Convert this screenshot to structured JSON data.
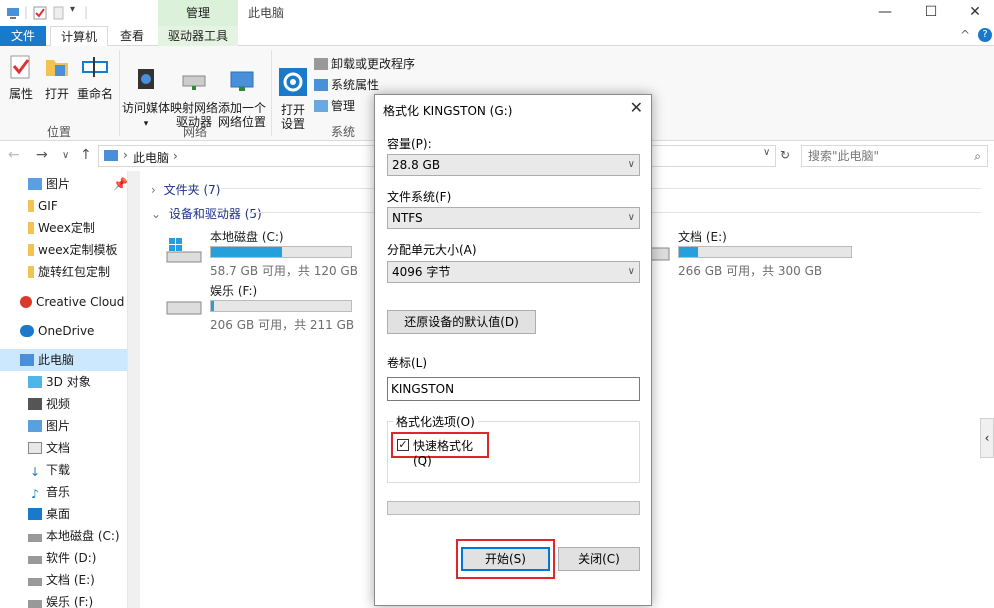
{
  "titlebar": {
    "context_tab": "管理",
    "window_title": "此电脑",
    "minimize": "—",
    "maximize": "☐",
    "close": "✕"
  },
  "tabs": [
    {
      "label": "文件"
    },
    {
      "label": "计算机"
    },
    {
      "label": "查看"
    },
    {
      "label": "驱动器工具"
    }
  ],
  "ribbon": {
    "location_group": {
      "label": "位置",
      "buttons": [
        "属性",
        "打开",
        "重命名"
      ]
    },
    "network_group": {
      "label": "网络",
      "buttons": [
        "访问媒体",
        "映射网络\n驱动器",
        "添加一个\n网络位置"
      ]
    },
    "system_group": {
      "label": "系统",
      "open_settings": "打开\n设置",
      "items": [
        "卸载或更改程序",
        "系统属性",
        "管理"
      ]
    }
  },
  "address": {
    "path": "此电脑",
    "search_placeholder": "搜索\"此电脑\""
  },
  "sidebar": {
    "items": [
      {
        "label": "图片"
      },
      {
        "label": "GIF"
      },
      {
        "label": "Weex定制"
      },
      {
        "label": "weex定制模板"
      },
      {
        "label": "旋转红包定制"
      },
      {
        "label": "Creative Cloud F"
      },
      {
        "label": "OneDrive"
      },
      {
        "label": "此电脑"
      },
      {
        "label": "3D 对象"
      },
      {
        "label": "视频"
      },
      {
        "label": "图片"
      },
      {
        "label": "文档"
      },
      {
        "label": "下载"
      },
      {
        "label": "音乐"
      },
      {
        "label": "桌面"
      },
      {
        "label": "本地磁盘 (C:)"
      },
      {
        "label": "软件 (D:)"
      },
      {
        "label": "文档 (E:)"
      },
      {
        "label": "娱乐 (F:)"
      }
    ]
  },
  "content": {
    "folders_header": "文件夹 (7)",
    "drives_header": "设备和驱动器 (5)",
    "drives": [
      {
        "name": "本地磁盘 (C:)",
        "size": "58.7 GB 可用，共 120 GB",
        "used_fraction": 0.51
      },
      {
        "name": "文档 (E:)",
        "size": "266 GB 可用，共 300 GB",
        "used_fraction": 0.11
      },
      {
        "name": "娱乐 (F:)",
        "size": "206 GB 可用，共 211 GB",
        "used_fraction": 0.02
      }
    ]
  },
  "dialog": {
    "title": "格式化 KINGSTON (G:)",
    "close": "✕",
    "capacity_label": "容量(P):",
    "capacity_value": "28.8 GB",
    "filesystem_label": "文件系统(F)",
    "filesystem_value": "NTFS",
    "alloc_label": "分配单元大小(A)",
    "alloc_value": "4096 字节",
    "restore_button": "还原设备的默认值(D)",
    "volume_label": "卷标(L)",
    "volume_value": "KINGSTON",
    "options_label": "格式化选项(O)",
    "quick_format_label": "快速格式化(Q)",
    "quick_format_checked": "✓",
    "start_button": "开始(S)",
    "close_button": "关闭(C)"
  },
  "colors": {
    "accent": "#1979ca",
    "highlight": "#e0262a",
    "drive_fill": "#26a0da"
  }
}
